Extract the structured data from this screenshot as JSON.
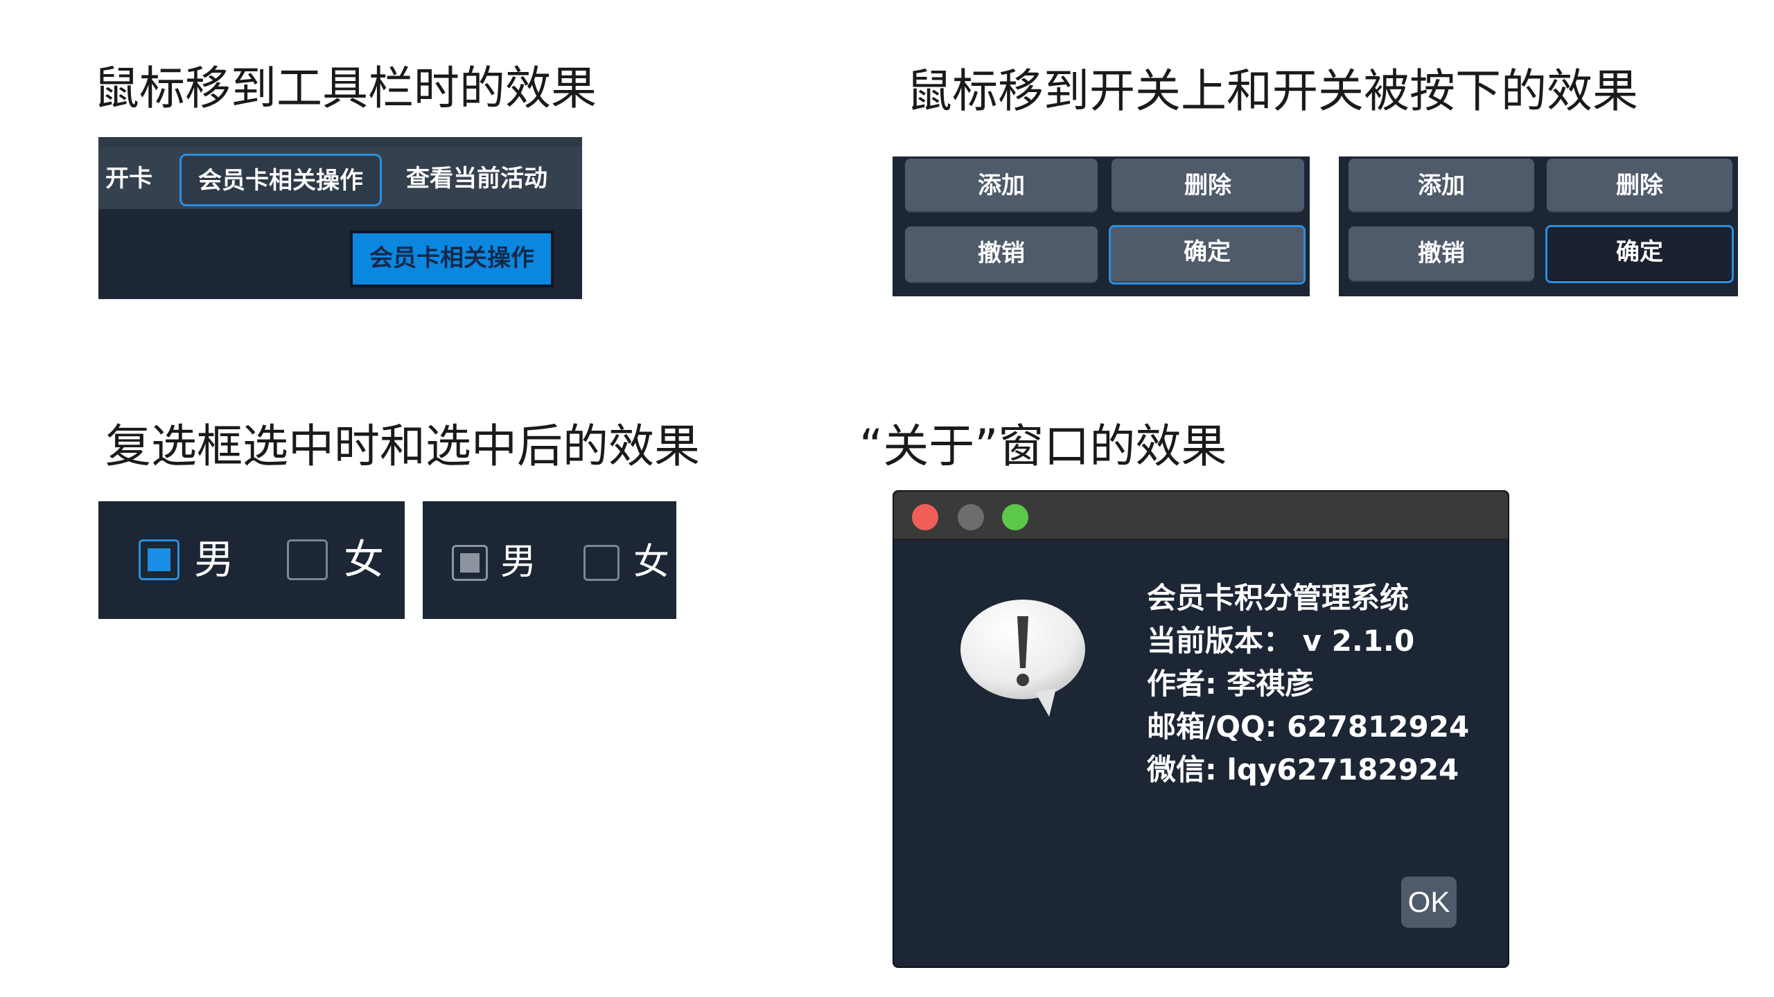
{
  "captions": {
    "toolbar": "鼠标移到工具栏时的效果",
    "switch": "鼠标移到开关上和开关被按下的效果",
    "checkbox": "复选框选中时和选中后的效果",
    "about": "“关于”窗口的效果"
  },
  "toolbar_demo": {
    "items": [
      "开卡",
      "会员卡相关操作",
      "查看当前活动"
    ],
    "popup_label": "会员卡相关操作"
  },
  "switch_demo": {
    "panels": [
      {
        "add": "添加",
        "delete": "删除",
        "undo": "撤销",
        "confirm": "确定",
        "confirm_state": "hover"
      },
      {
        "add": "添加",
        "delete": "删除",
        "undo": "撤销",
        "confirm": "确定",
        "confirm_state": "pressed"
      }
    ]
  },
  "checkbox_demo": {
    "panels": [
      {
        "male": "男",
        "female": "女",
        "male_state": "checked-hover"
      },
      {
        "male": "男",
        "female": "女",
        "male_state": "checked"
      }
    ]
  },
  "about_dialog": {
    "lines": [
      "会员卡积分管理系统",
      "当前版本： v 2.1.0",
      "作者: 李祺彦",
      "邮箱/QQ: 627812924",
      "微信: lqy627182924"
    ],
    "ok_label": "OK",
    "icon": "exclamation-speech-bubble-icon",
    "traffic_lights": [
      "#ee5f58",
      "#6d6d6d",
      "#5cc84a"
    ]
  },
  "colors": {
    "panel_bg": "#1c2634",
    "accent_blue": "#2a8fe0",
    "button_bg": "#4f5b6a"
  }
}
